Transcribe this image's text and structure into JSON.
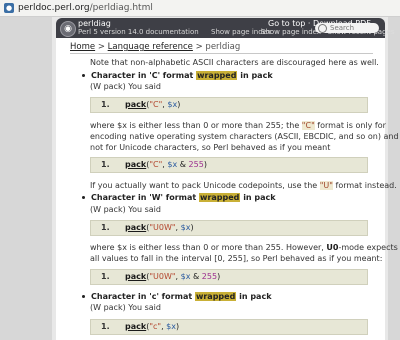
{
  "browser": {
    "url_domain": "perldoc.perl.org",
    "url_path": "/perldiag.html"
  },
  "header": {
    "title": "perldiag",
    "version": "Perl 5 version 14.0 documentation",
    "overlay": "Show page index",
    "nav_top": "Go to top · Download PDF",
    "nav_bottom": "Show page index · Show recent pages",
    "search_placeholder": "Search"
  },
  "breadcrumbs": {
    "home": "Home",
    "section": "Language reference",
    "current": "perldiag"
  },
  "intro": "Note that non-alphabetic ASCII characters are discouraged here as well.",
  "items": [
    {
      "head_pre": "Character in 'C' format",
      "head_hl": "wrapped",
      "head_post": "in pack",
      "sub": "(W pack) You said",
      "code1": {
        "num": "1.",
        "fn": "pack",
        "args_a": "\"C\"",
        "args_b": "$x"
      },
      "p1": "where $x is either less than 0 or more than 255; the",
      "p1_code": "\"C\"",
      "p1_post": "format is only for",
      "p2": "encoding native operating system characters (ASCII, EBCDIC, and so on) and",
      "p3": "not for Unicode characters, so Perl behaved as if you meant",
      "code2": {
        "num": "1.",
        "fn": "pack",
        "args_a": "\"C\"",
        "args_b": "$x",
        "op": "&",
        "n": "255"
      },
      "p4": "If you actually want to pack Unicode codepoints, use the",
      "p4_code": "\"U\"",
      "p4_post": "format instead."
    },
    {
      "head_pre": "Character in 'W' format",
      "head_hl": "wrapped",
      "head_post": "in pack",
      "sub": "(W pack) You said",
      "code1": {
        "num": "1.",
        "fn": "pack",
        "args_a": "\"U0W\"",
        "args_b": "$x"
      },
      "p1": "where $x is either less than 0 or more than 255. However,",
      "p1_code": "U0",
      "p1_post": "-mode expects",
      "p2": "all values to fall in the interval [0, 255], so Perl behaved as if you meant:",
      "code2": {
        "num": "1.",
        "fn": "pack",
        "args_a": "\"U0W\"",
        "args_b": "$x",
        "op": "&",
        "n": "255"
      }
    },
    {
      "head_pre": "Character in 'c' format",
      "head_hl": "wrapped",
      "head_post": "in pack",
      "sub": "(W pack) You said",
      "code1": {
        "num": "1.",
        "fn": "pack",
        "args_a": "\"c\"",
        "args_b": "$x"
      }
    }
  ]
}
